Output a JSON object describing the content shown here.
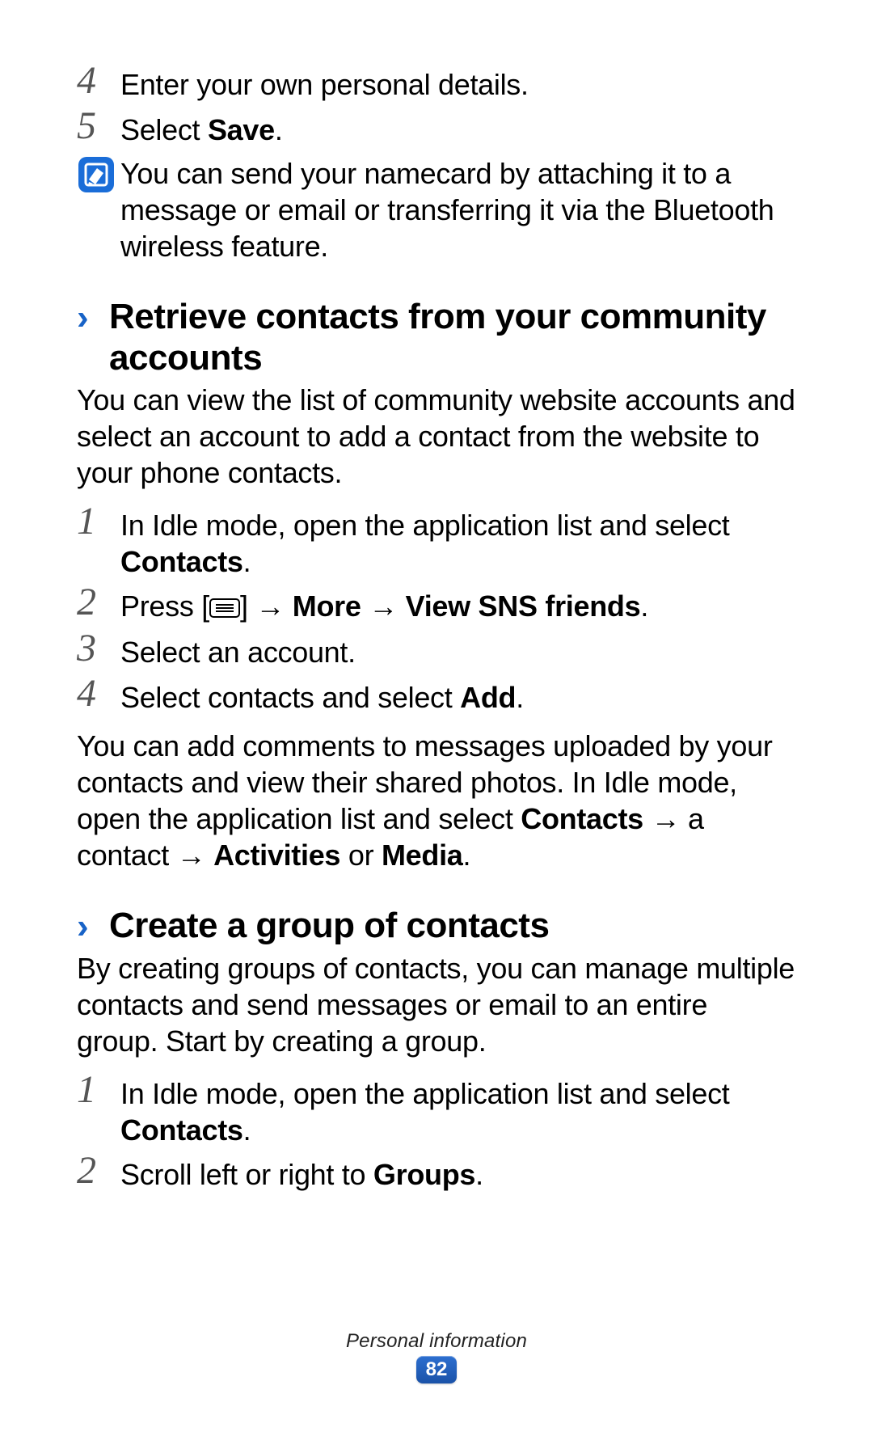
{
  "top_steps": [
    {
      "num": "4",
      "html": "Enter your own personal details."
    },
    {
      "num": "5",
      "html": "Select <b>Save</b>."
    }
  ],
  "note": "You can send your namecard by attaching it to a message or email or transferring it via the Bluetooth wireless feature.",
  "section1": {
    "title": "Retrieve contacts from your community accounts",
    "intro": "You can view the list of community website accounts and select an account to add a contact from the website to your phone contacts.",
    "steps": [
      {
        "num": "1",
        "html": "In Idle mode, open the application list and select <b>Contacts</b>."
      },
      {
        "num": "2",
        "html": "Press [MENU_KEY] → <b>More</b> → <b>View SNS friends</b>."
      },
      {
        "num": "3",
        "html": "Select an account."
      },
      {
        "num": "4",
        "html": "Select contacts and select <b>Add</b>."
      }
    ],
    "after": "You can add comments to messages uploaded by your contacts and view their shared photos. In Idle mode, open the application list and select <b>Contacts</b> → a contact → <b>Activities</b> or <b>Media</b>."
  },
  "section2": {
    "title": "Create a group of contacts",
    "intro": "By creating groups of contacts, you can manage multiple contacts and send messages or email to an entire group. Start by creating a group.",
    "steps": [
      {
        "num": "1",
        "html": "In Idle mode, open the application list and select <b>Contacts</b>."
      },
      {
        "num": "2",
        "html": "Scroll left or right to <b>Groups</b>."
      }
    ]
  },
  "footer": {
    "label": "Personal information",
    "page": "82"
  }
}
